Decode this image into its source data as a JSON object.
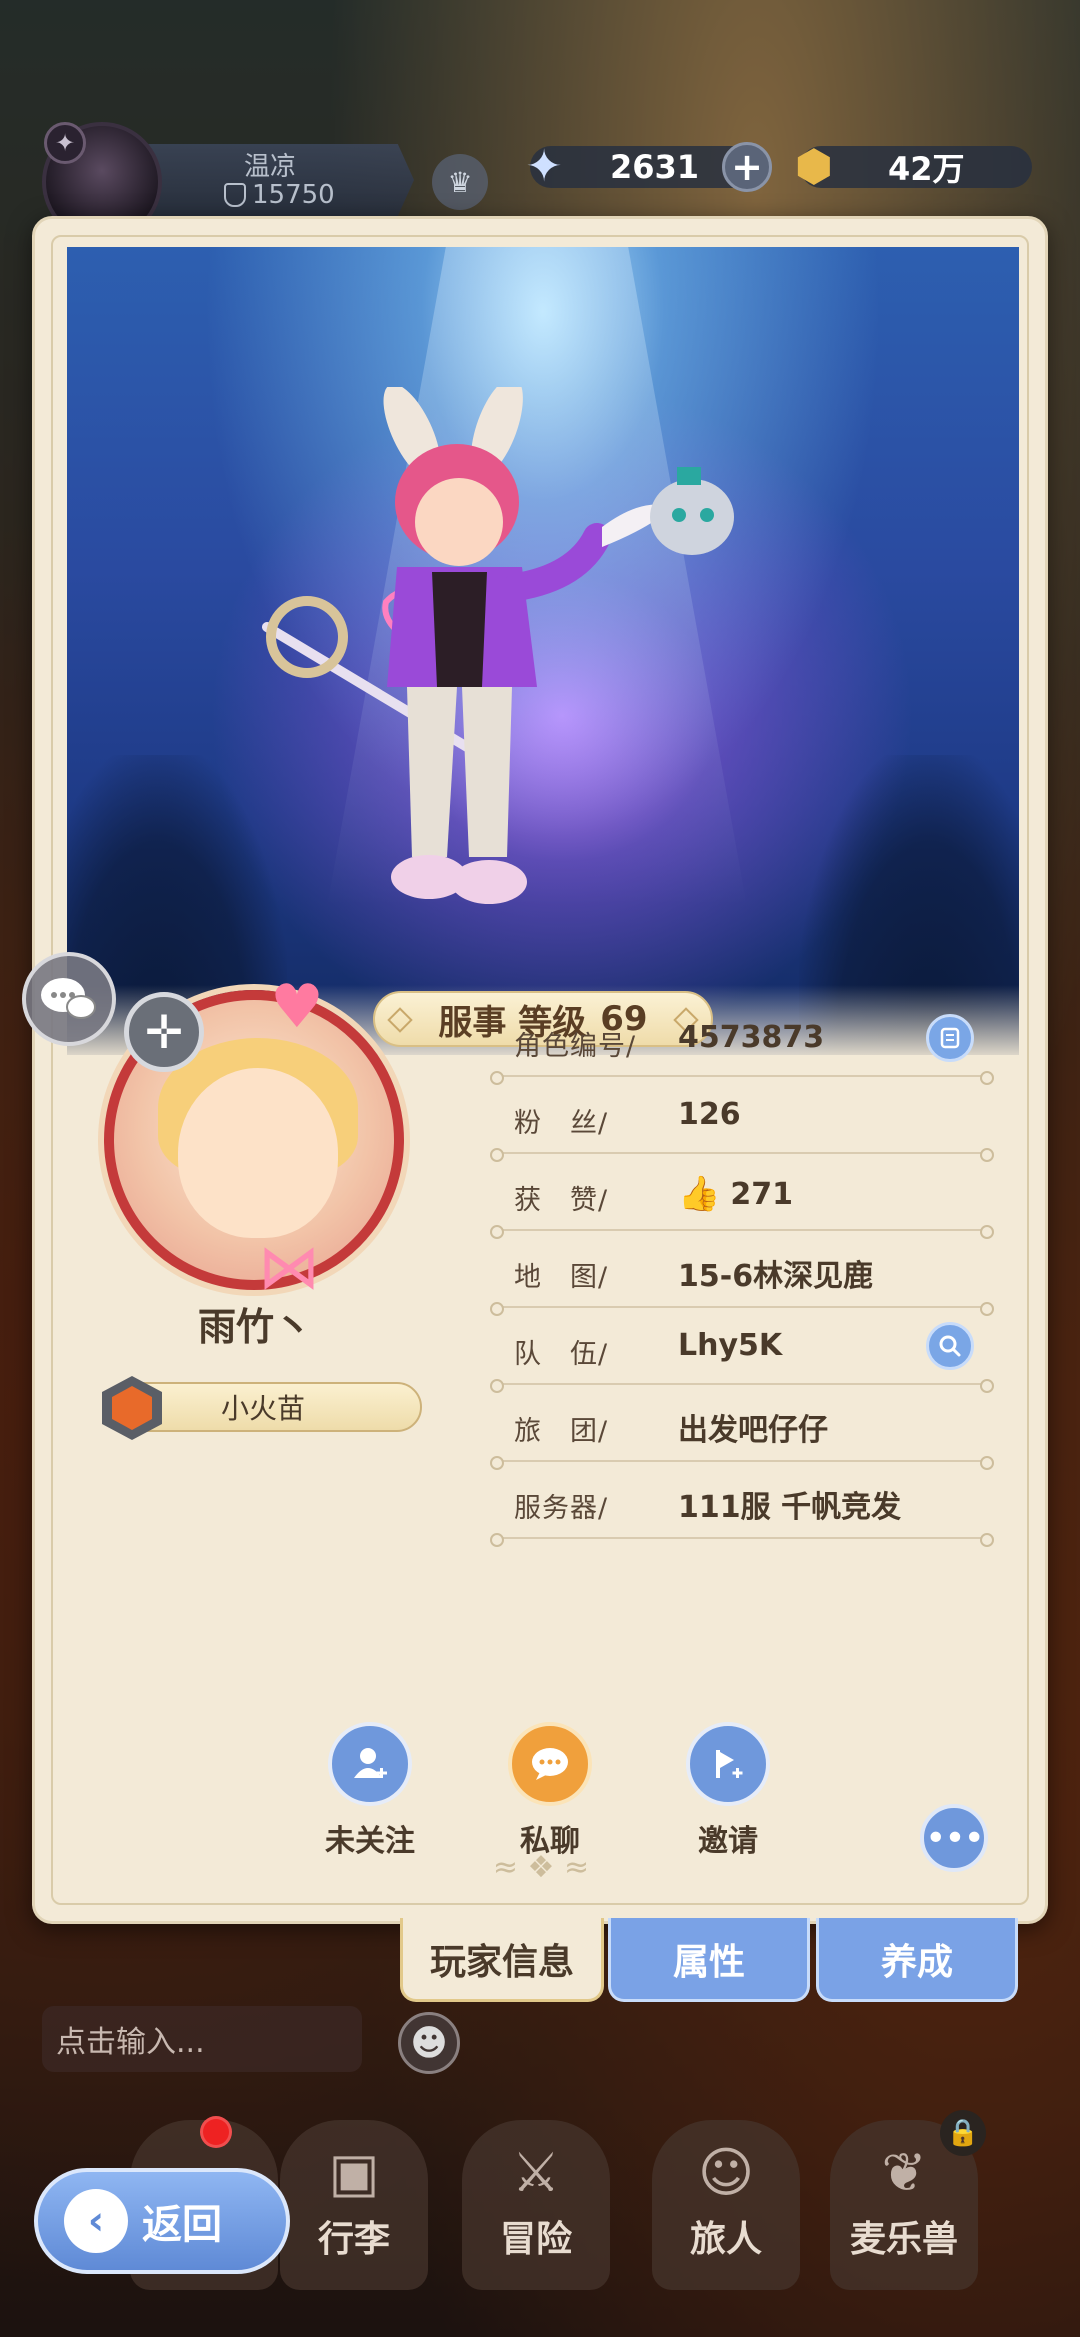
{
  "header": {
    "player_name": "温凉",
    "player_score": "15750"
  },
  "currency": {
    "diamond_value": "2631",
    "gold_value": "42万"
  },
  "showcase": {
    "level_label": "服事 等级",
    "level_value": "69"
  },
  "profile": {
    "name": "雨竹丶",
    "title": "小火苗",
    "rows": [
      {
        "label": "角色编号/",
        "value": "4573873"
      },
      {
        "label": "粉　丝/",
        "value": "126"
      },
      {
        "label": "获　赞/",
        "value": "271"
      },
      {
        "label": "地　图/",
        "value": "15-6林深见鹿"
      },
      {
        "label": "队　伍/",
        "value": "Lhy5K"
      },
      {
        "label": "旅　团/",
        "value": "出发吧仔仔"
      },
      {
        "label": "服务器/",
        "value": "111服  千帆竞发"
      }
    ]
  },
  "actions": {
    "follow_label": "未关注",
    "chat_label": "私聊",
    "invite_label": "邀请"
  },
  "tabs": [
    "玩家信息",
    "属性",
    "养成"
  ],
  "chat": {
    "placeholder": "点击输入..."
  },
  "nav": {
    "back_label": "返回",
    "items": [
      "行李",
      "冒险",
      "旅人",
      "麦乐兽"
    ]
  },
  "colors": {
    "card_bg": "#f3ead7",
    "accent_blue": "#6f98dc",
    "accent_orange": "#f0a03c",
    "text_brown": "#4a3a2a"
  }
}
